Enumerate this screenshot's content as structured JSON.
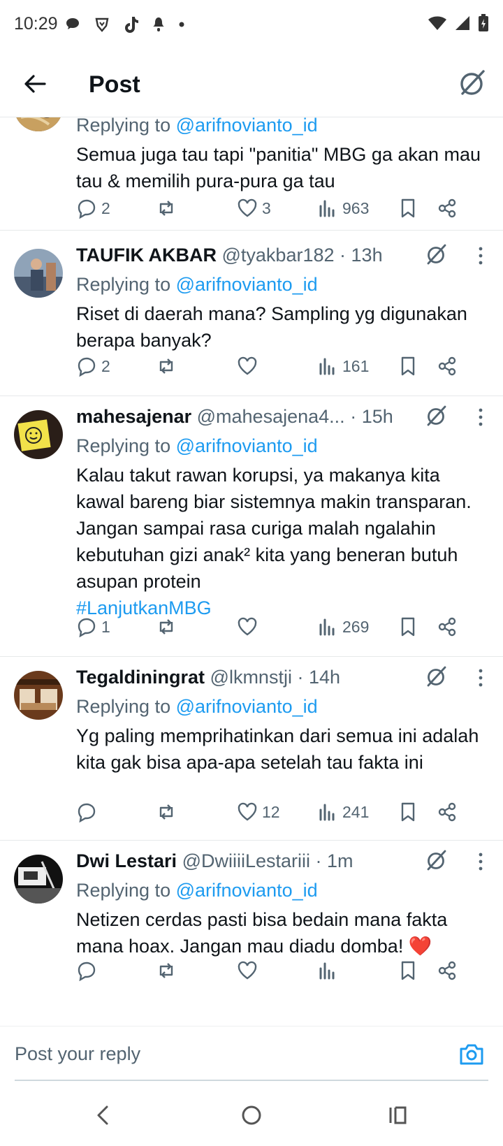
{
  "status_bar": {
    "time": "10:29",
    "left_icons": [
      "chat-bubble-icon",
      "brave-icon",
      "tiktok-icon",
      "notification-icon",
      "dot-icon"
    ],
    "right_icons": [
      "wifi-icon",
      "signal-icon",
      "battery-icon"
    ]
  },
  "header": {
    "title": "Post"
  },
  "tweets": [
    {
      "name": "",
      "handle": "",
      "age": "",
      "replying_label": "Replying to",
      "replying_to": "@arifnovianto_id",
      "text": "Semua juga tau tapi \"panitia\" MBG ga akan mau tau & memilih pura-pura ga tau",
      "replies": "2",
      "reposts": "",
      "likes": "3",
      "views": "963"
    },
    {
      "name": "TAUFIK AKBAR",
      "handle": "@tyakbar182",
      "age": "13h",
      "replying_label": "Replying to",
      "replying_to": "@arifnovianto_id",
      "text": "Riset di daerah mana? Sampling yg digunakan berapa banyak?",
      "replies": "2",
      "reposts": "",
      "likes": "",
      "views": "161"
    },
    {
      "name": "mahesajenar",
      "handle": "@mahesajena4...",
      "age": "15h",
      "replying_label": "Replying to",
      "replying_to": "@arifnovianto_id",
      "text": "Kalau takut rawan korupsi, ya makanya kita kawal bareng biar sistemnya makin transparan. Jangan sampai rasa curiga malah ngalahin kebutuhan gizi anak² kita yang beneran butuh asupan protein",
      "hashtag": "#LanjutkanMBG",
      "replies": "1",
      "reposts": "",
      "likes": "",
      "views": "269"
    },
    {
      "name": "Tegaldiningrat",
      "handle": "@lkmnstji",
      "age": "14h",
      "replying_label": "Replying to",
      "replying_to": "@arifnovianto_id",
      "text": "Yg paling memprihatinkan dari semua ini adalah kita gak bisa apa-apa setelah tau fakta ini",
      "replies": "",
      "reposts": "",
      "likes": "12",
      "views": "241"
    },
    {
      "name": "Dwi Lestari",
      "handle": "@DwiiiiLestariii",
      "age": "1m",
      "replying_label": "Replying to",
      "replying_to": "@arifnovianto_id",
      "text": "Netizen cerdas pasti bisa bedain mana fakta mana hoax. Jangan mau diadu domba! ❤️",
      "replies": "",
      "reposts": "",
      "likes": "",
      "views": ""
    }
  ],
  "reply_bar": {
    "placeholder": "Post your reply"
  },
  "colors": {
    "accent": "#1d9bf0",
    "secondary_text": "#536471",
    "primary_text": "#0f1419",
    "divider": "#e6e9ea"
  }
}
